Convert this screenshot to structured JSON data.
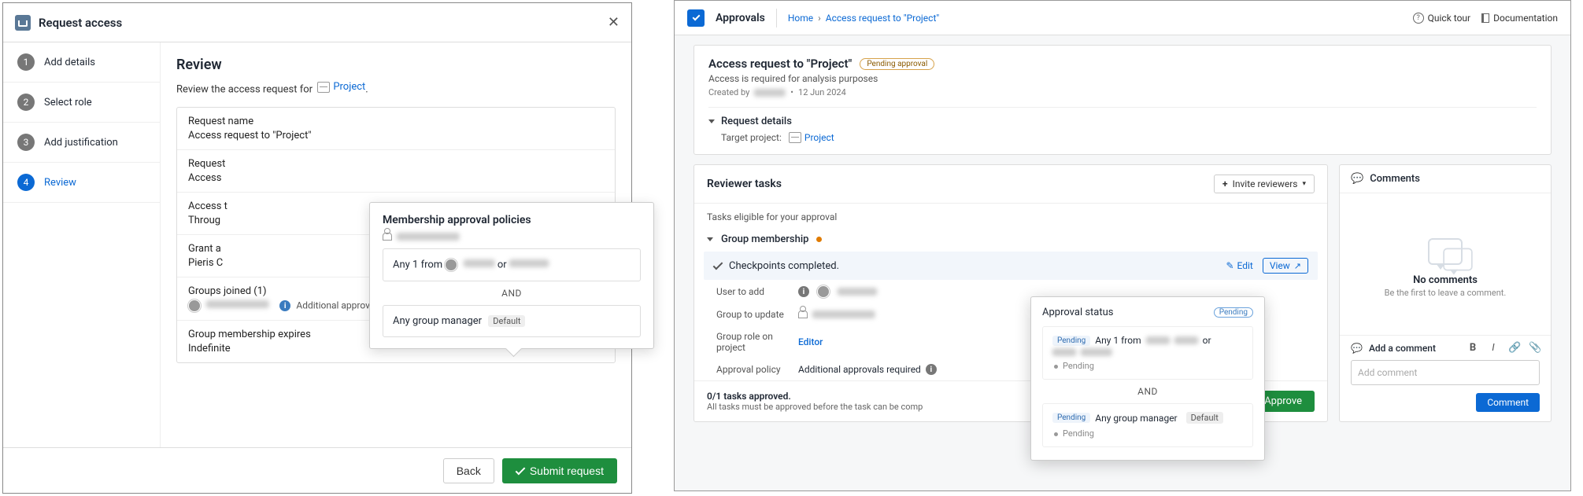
{
  "left": {
    "header_title": "Request access",
    "steps": [
      {
        "num": "1",
        "label": "Add details"
      },
      {
        "num": "2",
        "label": "Select role"
      },
      {
        "num": "3",
        "label": "Add justification"
      },
      {
        "num": "4",
        "label": "Review"
      }
    ],
    "review_heading": "Review",
    "review_sub_prefix": "Review the access request for",
    "project_link": "Project",
    "period": ".",
    "rows": {
      "name_label": "Request name",
      "name_value": "Access request to \"Project\"",
      "desc_label": "Request",
      "desc_value": "Access",
      "access_label": "Access t",
      "access_value": "Throug",
      "grant_label": "Grant a",
      "grant_value": "Pieris C",
      "groups_label": "Groups joined (1)",
      "groups_extra": "Additional approvals required",
      "expires_label": "Group membership expires",
      "expires_value": "Indefinite"
    },
    "popover": {
      "title": "Membership approval policies",
      "rule1_prefix": "Any 1 from",
      "rule1_or": "or",
      "and": "AND",
      "rule2": "Any group manager",
      "rule2_tag": "Default"
    },
    "back": "Back",
    "submit": "Submit request"
  },
  "right": {
    "app": "Approvals",
    "crumb_home": "Home",
    "crumb_page": "Access request to \"Project\"",
    "quick_tour": "Quick tour",
    "documentation": "Documentation",
    "card": {
      "title": "Access request to \"Project\"",
      "badge": "Pending approval",
      "sub": "Access is required for analysis purposes",
      "created_by": "Created by",
      "date_sep": "•",
      "date": "12 Jun 2024",
      "details_toggle": "Request details",
      "target_label": "Target project:",
      "target_value": "Project"
    },
    "tasks": {
      "heading": "Reviewer tasks",
      "invite": "Invite reviewers",
      "eligible": "Tasks eligible for your approval",
      "group_membership": "Group membership",
      "checkpoints": "Checkpoints completed.",
      "edit": "Edit",
      "view": "View",
      "kv": {
        "user_add": "User to add",
        "group_update": "Group to update",
        "role": "Group role on project",
        "role_val": "Editor",
        "policy": "Approval policy",
        "policy_val": "Additional approvals required"
      },
      "approved_line": "0/1 tasks approved.",
      "approved_sub": "All tasks must be approved before the task can be comp",
      "approve_btn": "Approve"
    },
    "approval_pop": {
      "title": "Approval status",
      "pending": "Pending",
      "r1_prefix": "Any 1 from",
      "r1_or": "or",
      "and": "AND",
      "r2": "Any group manager",
      "r2_tag": "Default"
    },
    "comments": {
      "title": "Comments",
      "none": "No comments",
      "hint": "Be the first to leave a comment.",
      "add": "Add a comment",
      "placeholder": "Add comment",
      "btn": "Comment"
    }
  }
}
